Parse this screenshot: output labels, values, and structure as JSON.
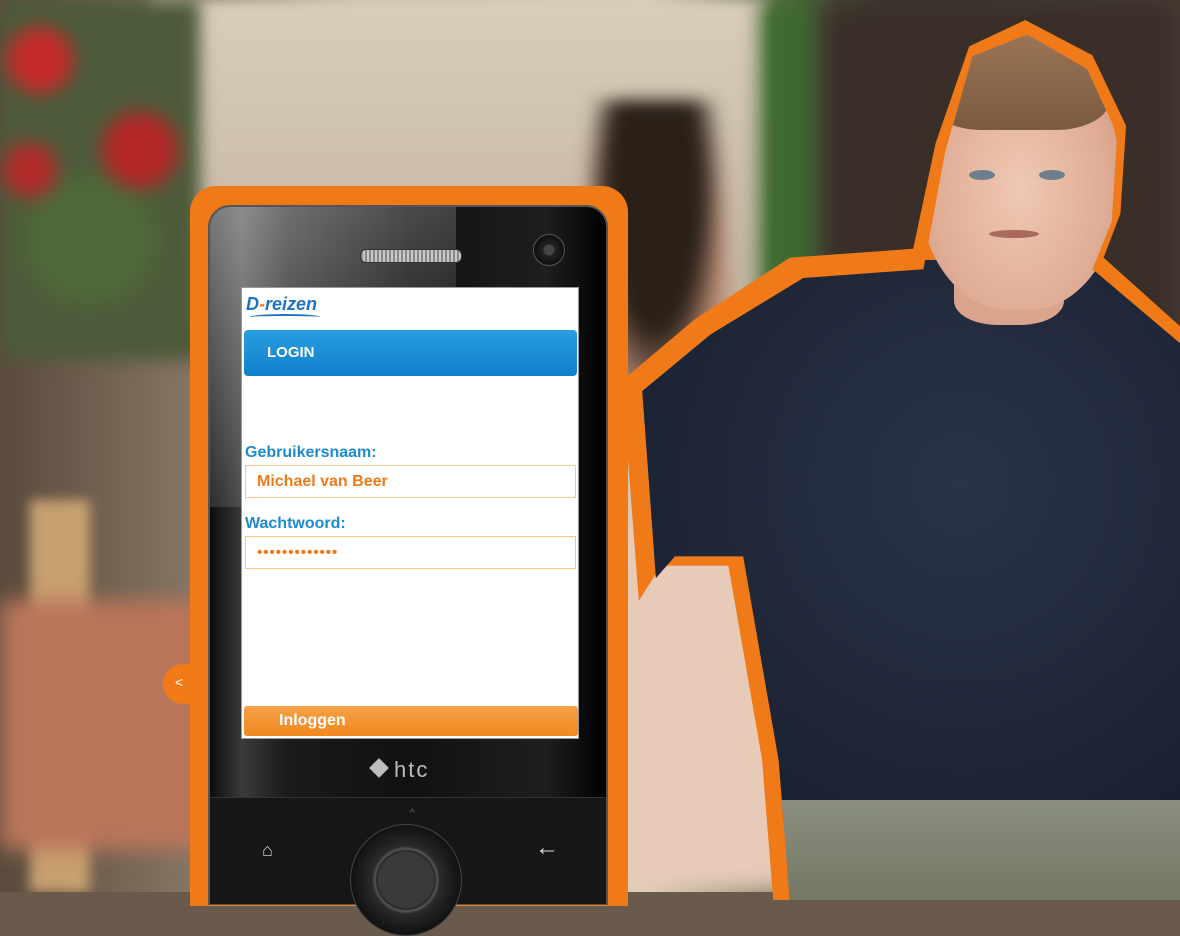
{
  "app": {
    "logo_text_left": "D",
    "logo_text_right": "reizen"
  },
  "header": {
    "title": "LOGIN"
  },
  "form": {
    "username_label": "Gebruikersnaam:",
    "username_value": "Michael van Beer",
    "password_label": "Wachtwoord:",
    "password_value": "•••••••••••••",
    "submit_label": "Inloggen"
  },
  "device": {
    "brand": "htc",
    "home_icon": "⌂",
    "back_icon": "←"
  },
  "decor": {
    "outline_tab_icon": "<",
    "accent_color": "#f07a18",
    "primary_color": "#1e8ad0"
  }
}
